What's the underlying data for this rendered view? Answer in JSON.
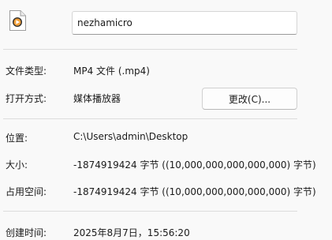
{
  "icon": "video-file-icon",
  "file_name": "nezhamicro",
  "rows": {
    "type": {
      "label": "文件类型:",
      "value": "MP4 文件 (.mp4)"
    },
    "opens_with": {
      "label": "打开方式:",
      "value": "媒体播放器",
      "button_label": "更改(C)..."
    },
    "location": {
      "label": "位置:",
      "value": "C:\\Users\\admin\\Desktop"
    },
    "size": {
      "label": "大小:",
      "value": "-1874919424 字节 ((10,000,000,000,000,000) 字节)"
    },
    "size_on_disk": {
      "label": "占用空间:",
      "value": "-1874919424 字节 ((10,000,000,000,000,000) 字节)"
    },
    "created": {
      "label": "创建时间:",
      "value": "2025年8月7日，15:56:20"
    }
  }
}
